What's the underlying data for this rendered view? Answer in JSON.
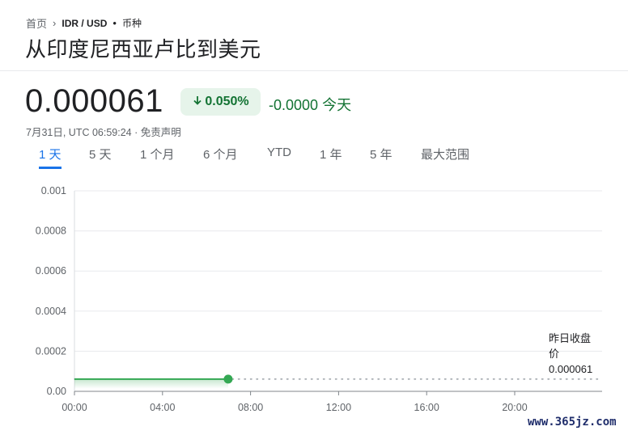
{
  "breadcrumb": {
    "home": "首页",
    "pair": "IDR / USD",
    "kind": "币种"
  },
  "title": "从印度尼西亚卢比到美元",
  "price": "0.000061",
  "change": {
    "percent": "0.050%",
    "absolute": "-0.0000",
    "period": "今天",
    "color": "#137333"
  },
  "timestamp": "7月31日, UTC 06:59:24 · 免责声明",
  "tabs": [
    {
      "label": "1 天",
      "active": true
    },
    {
      "label": "5 天",
      "active": false
    },
    {
      "label": "1 个月",
      "active": false
    },
    {
      "label": "6 个月",
      "active": false
    },
    {
      "label": "YTD",
      "active": false
    },
    {
      "label": "1 年",
      "active": false
    },
    {
      "label": "5 年",
      "active": false
    },
    {
      "label": "最大范围",
      "active": false
    }
  ],
  "previous_close": {
    "label_line1": "昨日收盘",
    "label_line2": "价",
    "value": "0.000061"
  },
  "watermark": "www.365jz.com",
  "chart_data": {
    "type": "line",
    "series": [
      {
        "values": [
          {
            "x": "00:00",
            "y": 6.1e-05
          },
          {
            "x": "02:00",
            "y": 6.1e-05
          },
          {
            "x": "04:00",
            "y": 6.1e-05
          },
          {
            "x": "06:00",
            "y": 6.1e-05
          },
          {
            "x": "06:59",
            "y": 6.1e-05
          }
        ]
      }
    ],
    "previous_close": 6.1e-05,
    "y_ticks": [
      "0.001",
      "0.0008",
      "0.0006",
      "0.0004",
      "0.0002",
      "0.00"
    ],
    "y_tick_values": [
      0.001,
      0.0008,
      0.0006,
      0.0004,
      0.0002,
      0
    ],
    "x_ticks": [
      "00:00",
      "04:00",
      "08:00",
      "12:00",
      "16:00",
      "20:00"
    ],
    "x_tick_hours": [
      0,
      4,
      8,
      12,
      16,
      20
    ],
    "ylim": [
      0,
      0.001
    ],
    "xlim_hours": [
      0,
      24
    ],
    "line_color": "#34a853",
    "grid": true
  }
}
